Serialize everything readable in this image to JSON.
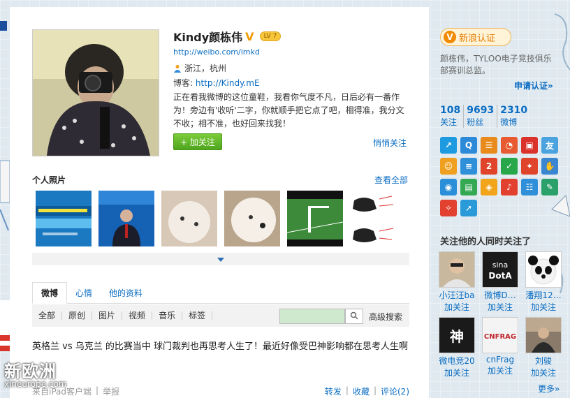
{
  "profile": {
    "name": "Kindy颜栋伟",
    "level_badge": "LV 7",
    "weibo_url": "http://weibo.com/imkd",
    "location": "浙江，杭州",
    "blog_label": "博客:",
    "blog_url": "http://Kindy.mE",
    "bio": "正在看我微博的这位童鞋，我看你气度不凡，日后必有一番作为！旁边有'收听'二字，你就顺手把它点了吧，相得准，我分文不收；相不准，也好回来找我！",
    "follow_button": "+ 加关注",
    "quiet_follow": "悄悄关注"
  },
  "photos": {
    "title": "个人照片",
    "view_all": "查看全部"
  },
  "tabs": [
    {
      "label": "微博",
      "active": true
    },
    {
      "label": "心情",
      "active": false
    },
    {
      "label": "他的资料",
      "active": false
    }
  ],
  "filters": [
    "全部",
    "原创",
    "图片",
    "视频",
    "音乐",
    "标签"
  ],
  "advanced_search": "高级搜索",
  "post": {
    "text": "英格兰 vs 乌克兰 的比赛当中 球门裁判也再思考人生了！最近好像受巴神影响都在思考人生啊",
    "source": "来自iPad客户端",
    "report": "举报",
    "repost": "转发",
    "favorite": "收藏",
    "comment": "评论(2)"
  },
  "watermark": {
    "big": "新欧洲",
    "small": "xineurope.com"
  },
  "sidebar": {
    "verify_label": "新浪认证",
    "verify_desc": "颜栋伟，TYLOO电子竞技俱乐部赛训总监。",
    "apply_verify": "申请认证»",
    "stats": [
      {
        "num": "108",
        "label": "关注"
      },
      {
        "num": "9693",
        "label": "粉丝"
      },
      {
        "num": "2310",
        "label": "微博"
      }
    ],
    "apps": [
      {
        "icon": "share-icon",
        "glyph": "↗",
        "color": "#1e9be0"
      },
      {
        "icon": "search-app-icon",
        "glyph": "Q",
        "color": "#2d8ad8"
      },
      {
        "icon": "card-icon",
        "glyph": "☰",
        "color": "#e98b1c"
      },
      {
        "icon": "vote-icon",
        "glyph": "◔",
        "color": "#e85b32"
      },
      {
        "icon": "bus-icon",
        "glyph": "▣",
        "color": "#d9332b"
      },
      {
        "icon": "friend-icon",
        "glyph": "友",
        "color": "#4aa3df"
      },
      {
        "icon": "smile-icon",
        "glyph": "☺",
        "color": "#f0a020"
      },
      {
        "icon": "list-icon",
        "glyph": "≡",
        "color": "#2f8fd8"
      },
      {
        "icon": "anniversary-icon",
        "glyph": "2",
        "color": "#e0442a"
      },
      {
        "icon": "sport-icon",
        "glyph": "✓",
        "color": "#27a64a"
      },
      {
        "icon": "game-icon",
        "glyph": "✦",
        "color": "#e0442a"
      },
      {
        "icon": "hand-icon",
        "glyph": "✋",
        "color": "#3a86d0"
      },
      {
        "icon": "location-icon",
        "glyph": "◉",
        "color": "#2a8fd8"
      },
      {
        "icon": "book-icon",
        "glyph": "▤",
        "color": "#34a853"
      },
      {
        "icon": "shield-icon",
        "glyph": "◈",
        "color": "#f2a51a"
      },
      {
        "icon": "mic-icon",
        "glyph": "♪",
        "color": "#e2412f"
      },
      {
        "icon": "group-icon",
        "glyph": "☷",
        "color": "#2f8fd8"
      },
      {
        "icon": "edit-icon",
        "glyph": "✎",
        "color": "#2aa06a"
      },
      {
        "icon": "dance-icon",
        "glyph": "✧",
        "color": "#e2412f"
      },
      {
        "icon": "arrow-icon",
        "glyph": "➚",
        "color": "#2a9ad8"
      }
    ],
    "also_follow_title": "关注他的人同时关注了",
    "fans": [
      {
        "name": "小汪汪ba",
        "follow": "加关注"
      },
      {
        "name": "微博D…",
        "follow": "加关注"
      },
      {
        "name": "潘翔12…",
        "follow": "加关注"
      },
      {
        "name": "微电竞20",
        "follow": "加关注"
      },
      {
        "name": "cnFrag",
        "follow": "加关注"
      },
      {
        "name": "刘骏",
        "follow": "加关注"
      }
    ],
    "more": "更多»"
  }
}
